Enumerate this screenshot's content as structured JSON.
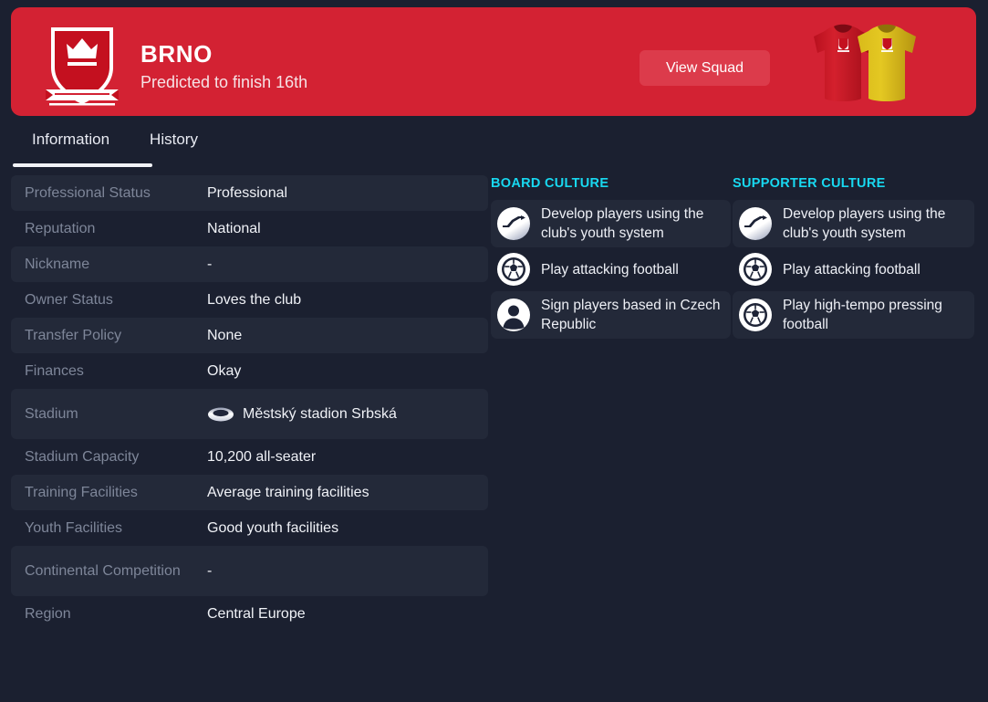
{
  "theme": {
    "page_bg": "#1b2030",
    "header_red": "#d32233",
    "button_red": "#dc3b4b",
    "row_stripe": "#232939",
    "accent_cyan": "#18d8f0",
    "label_grey": "#7e8699",
    "value_white": "#f0f2f7",
    "kit_home": "#cc1122",
    "kit_away": "#e0c01e"
  },
  "header": {
    "club_name": "BRNO",
    "prediction": "Predicted to finish 16th",
    "view_squad_label": "View Squad",
    "crest_icon": "shield-crown-crest-icon",
    "kits_icon": "team-kits-icon"
  },
  "tabs": [
    {
      "label": "Information",
      "active": true
    },
    {
      "label": "History",
      "active": false
    }
  ],
  "information": {
    "rows": [
      {
        "label": "Professional Status",
        "value": "Professional",
        "striped": true
      },
      {
        "label": "Reputation",
        "value": "National",
        "striped": false
      },
      {
        "label": "Nickname",
        "value": "-",
        "striped": true
      },
      {
        "label": "Owner Status",
        "value": "Loves the club",
        "striped": false
      },
      {
        "label": "Transfer Policy",
        "value": "None",
        "striped": true
      },
      {
        "label": "Finances",
        "value": "Okay",
        "striped": false
      },
      {
        "label": "Stadium",
        "value": "Městský stadion Srbská",
        "striped": true,
        "icon": "stadium-icon"
      },
      {
        "label": "Stadium Capacity",
        "value": "10,200 all-seater",
        "striped": false
      },
      {
        "label": "Training Facilities",
        "value": "Average training facilities",
        "striped": true
      },
      {
        "label": "Youth Facilities",
        "value": "Good youth facilities",
        "striped": false
      },
      {
        "label": "Continental Competition",
        "value": "-",
        "striped": true,
        "tall": true
      },
      {
        "label": "Region",
        "value": "Central Europe",
        "striped": false
      }
    ]
  },
  "board_culture": {
    "heading": "BOARD CULTURE",
    "items": [
      {
        "text": "Develop players using the club's youth system",
        "icon": "growth-arrow-icon",
        "striped": true
      },
      {
        "text": "Play attacking football",
        "icon": "football-icon",
        "striped": false
      },
      {
        "text": "Sign players based in Czech Republic",
        "icon": "person-icon",
        "striped": true
      }
    ]
  },
  "supporter_culture": {
    "heading": "SUPPORTER CULTURE",
    "items": [
      {
        "text": "Develop players using the club's youth system",
        "icon": "growth-arrow-icon",
        "striped": true
      },
      {
        "text": "Play attacking football",
        "icon": "football-icon",
        "striped": false
      },
      {
        "text": "Play high-tempo pressing football",
        "icon": "football-icon",
        "striped": true
      }
    ]
  }
}
